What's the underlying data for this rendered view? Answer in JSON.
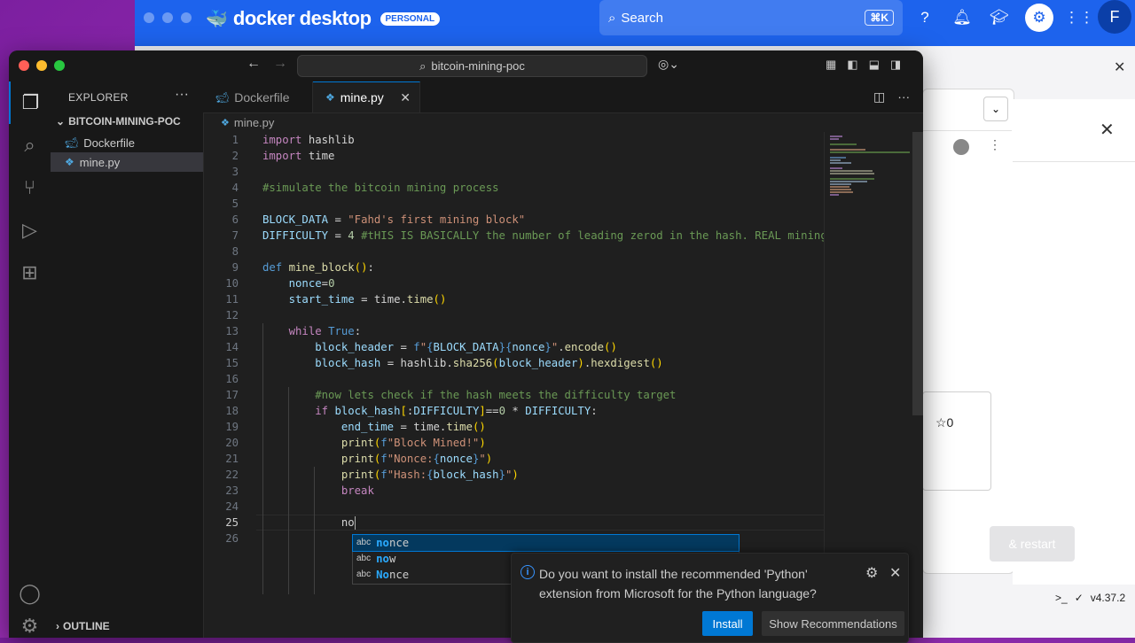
{
  "docker": {
    "logo_text": "docker desktop",
    "badge": "PERSONAL",
    "search_label": "Search",
    "search_shortcut": "⌘K",
    "avatar_letter": "F",
    "stars_count": "☆0",
    "restart_label": "& restart",
    "version": "v4.37.2"
  },
  "titlebar": {
    "command_center": "bitcoin-mining-poc"
  },
  "sidebar": {
    "title": "EXPLORER",
    "folder": "BITCOIN-MINING-POC",
    "files": [
      "Dockerfile",
      "mine.py"
    ],
    "outline": "OUTLINE"
  },
  "tabs": [
    {
      "label": "Dockerfile"
    },
    {
      "label": "mine.py"
    }
  ],
  "breadcrumb": "mine.py",
  "editor": {
    "current_line": 25,
    "line_numbers": [
      "1",
      "2",
      "3",
      "4",
      "5",
      "6",
      "7",
      "8",
      "9",
      "10",
      "11",
      "12",
      "13",
      "14",
      "15",
      "16",
      "17",
      "18",
      "19",
      "20",
      "21",
      "22",
      "23",
      "24",
      "25",
      "26"
    ]
  },
  "suggestions": [
    {
      "kind": "abc",
      "match": "no",
      "rest": "nce"
    },
    {
      "kind": "abc",
      "match": "no",
      "rest": "w"
    },
    {
      "kind": "abc",
      "match": "No",
      "rest": "nce"
    }
  ],
  "notification": {
    "message": "Do you want to install the recommended 'Python' extension from Microsoft for the Python language?",
    "install_label": "Install",
    "recommendations_label": "Show Recommendations"
  },
  "colors": {
    "accent": "#0078d4",
    "docker_blue": "#1d63ed",
    "editor_bg": "#1f1f1f"
  }
}
